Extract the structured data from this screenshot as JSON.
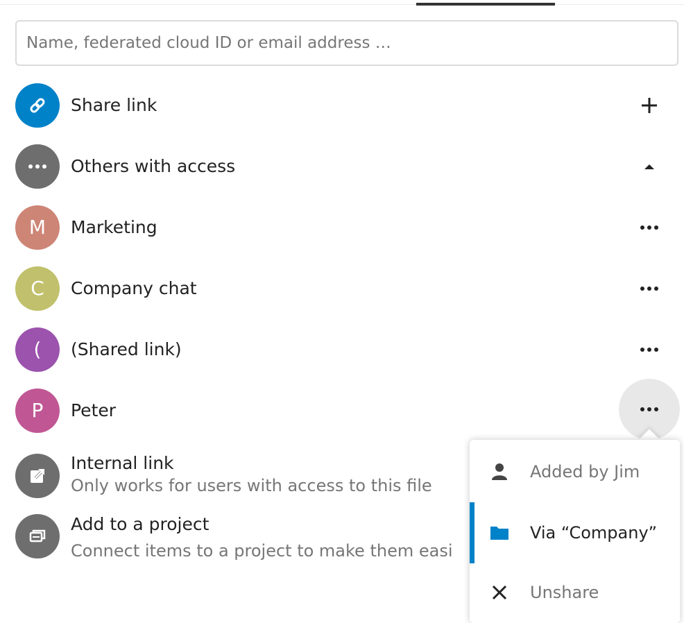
{
  "tabs": {
    "active_index": 1
  },
  "search": {
    "placeholder": "Name, federated cloud ID or email address …",
    "value": ""
  },
  "rows": {
    "share_link": {
      "label": "Share link",
      "action_icon": "plus-icon",
      "avatar_color": "#0082c9"
    },
    "others": {
      "label": "Others with access",
      "action_icon": "triangle-up-icon",
      "avatar_color": "#6e6e6e"
    },
    "marketing": {
      "initial": "M",
      "label": "Marketing",
      "avatar_color": "#cd8576"
    },
    "company_chat": {
      "initial": "C",
      "label": "Company chat",
      "avatar_color": "#c1c06c"
    },
    "shared_link": {
      "initial": "(",
      "label": "(Shared link)",
      "avatar_color": "#9b53ad"
    },
    "peter": {
      "initial": "P",
      "label": "Peter",
      "avatar_color": "#c05794"
    },
    "internal_link": {
      "title": "Internal link",
      "subtitle": "Only works for users with access to this file",
      "avatar_color": "#6e6e6e"
    },
    "project": {
      "title": "Add to a project",
      "subtitle": "Connect items to a project to make them easi",
      "avatar_color": "#6e6e6e"
    }
  },
  "popover_menu": {
    "items": [
      {
        "label": "Added by Jim",
        "icon": "user-icon",
        "color": "#767676"
      },
      {
        "label": "Via “Company”",
        "icon": "folder-icon",
        "color": "#222222",
        "active": true
      },
      {
        "label": "Unshare",
        "icon": "close-icon",
        "color": "#767676"
      }
    ],
    "accent_color": "#0082c9"
  }
}
